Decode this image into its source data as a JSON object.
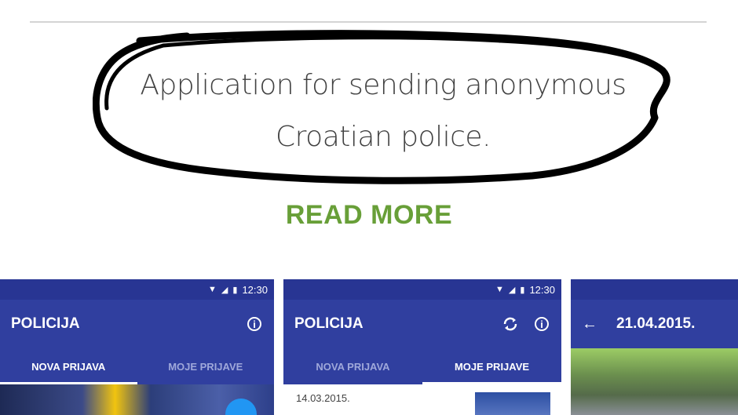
{
  "description": {
    "line1": "Application for sending anonymous",
    "line2": "Croatian police."
  },
  "read_more_label": "READ MORE",
  "screenshots": [
    {
      "status_time": "12:30",
      "app_title": "POLICIJA",
      "tabs": [
        "NOVA PRIJAVA",
        "MOJE PRIJAVE"
      ],
      "active_tab": "NOVA PRIJAVA"
    },
    {
      "status_time": "12:30",
      "app_title": "POLICIJA",
      "tabs": [
        "NOVA PRIJAVA",
        "MOJE PRIJAVE"
      ],
      "active_tab": "MOJE PRIJAVE",
      "first_item_date": "14.03.2015."
    },
    {
      "title": "21.04.2015."
    }
  ],
  "colors": {
    "app_bar": "#303f9f",
    "status_bar": "#283593",
    "read_more": "#689f38",
    "fab": "#2196f3"
  },
  "icons": [
    "info-icon",
    "refresh-icon",
    "back-arrow-icon",
    "wifi-icon",
    "signal-icon",
    "battery-icon"
  ]
}
